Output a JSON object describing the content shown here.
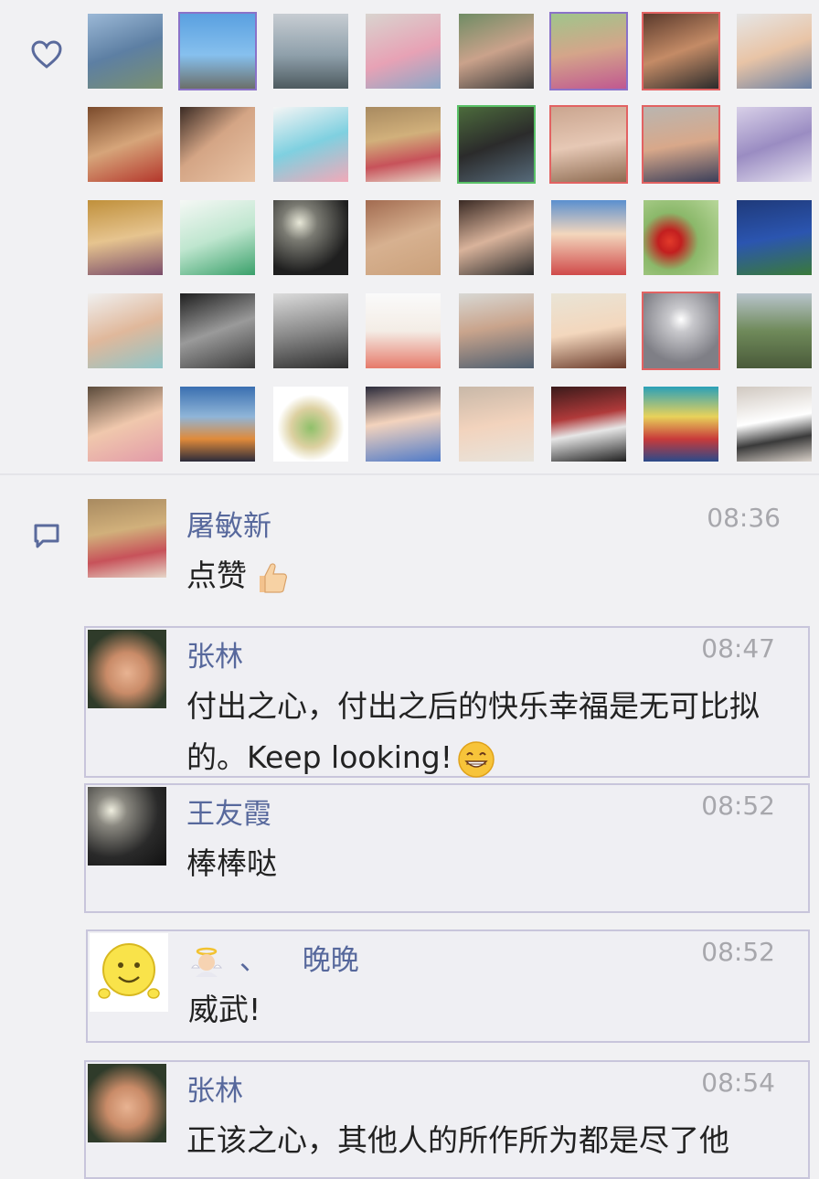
{
  "likes": {
    "icon": "heart-icon",
    "avatar_count": 40
  },
  "comments_icon": "comment-bubble-icon",
  "comments": [
    {
      "name": "屠敏新",
      "time": "08:36",
      "text": "点赞",
      "emoji": "thumbs-up"
    },
    {
      "name": "张林",
      "time": "08:47",
      "text": "付出之心，付出之后的快乐幸福是无可比拟的。Keep looking!",
      "emoji": "grinning-face"
    },
    {
      "name": "王友霞",
      "time": "08:52",
      "text": "棒棒哒",
      "emoji": ""
    },
    {
      "name_prefix": "、",
      "name": "晚晚",
      "time": "08:52",
      "text": "威武!",
      "name_emoji": "angel-baby"
    },
    {
      "name": "张林",
      "time": "08:54",
      "text": "正该之心，其他人的所作所为都是尽了他"
    }
  ],
  "colors": {
    "background": "#f1f1f3",
    "name": "#57689c",
    "time": "#a7a7ac",
    "text": "#222222",
    "highlight_border": "#c8c5db"
  }
}
